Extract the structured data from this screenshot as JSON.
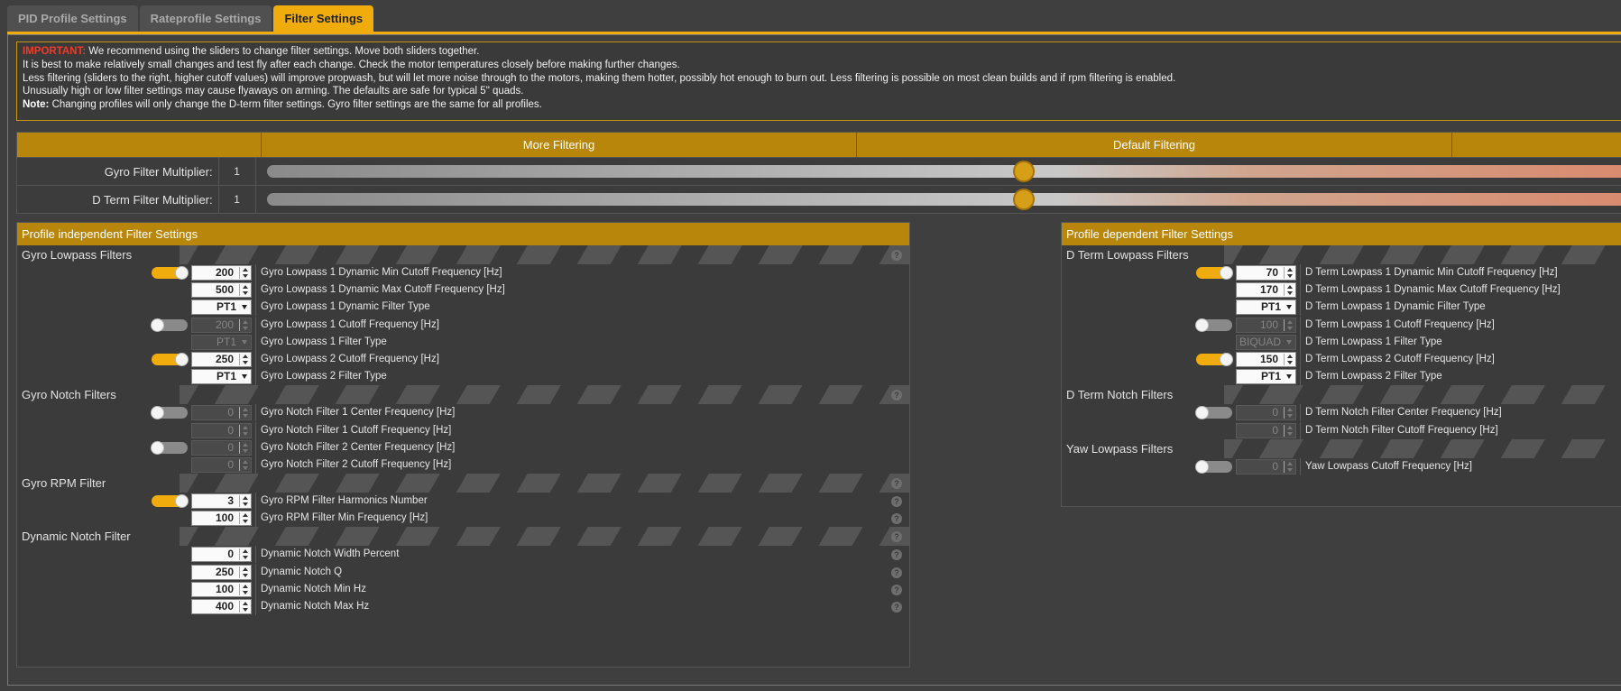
{
  "tabs": [
    {
      "label": "PID Profile Settings"
    },
    {
      "label": "Rateprofile Settings"
    },
    {
      "label": "Filter Settings"
    }
  ],
  "notice": {
    "important_label": "IMPORTANT:",
    "line1": " We recommend using the sliders to change filter settings. Move both sliders together.",
    "line2": "It is best to make relatively small changes and test fly after each change. Check the motor temperatures closely before making further changes.",
    "line3": "Less filtering (sliders to the right, higher cutoff values) will improve propwash, but will let more noise through to the motors, making them hotter, possibly hot enough to burn out. Less filtering is possible on most clean builds and if rpm filtering is enabled.",
    "line4": "Unusually high or low filter settings may cause flyaways on arming. The defaults are safe for typical 5\" quads.",
    "note_label": "Note:",
    "line5": " Changing profiles will only change the D-term filter settings. Gyro filter settings are the same for all profiles."
  },
  "sliders": {
    "more_filtering": "More Filtering",
    "default_filtering": "Default Filtering",
    "gyro_label": "Gyro Filter Multiplier:",
    "gyro_value": "1",
    "gyro_position": 0.555,
    "dterm_label": "D Term Filter Multiplier:",
    "dterm_value": "1",
    "dterm_position": 0.555
  },
  "left": {
    "title": "Profile independent Filter Settings",
    "help": "?",
    "gyro_lowpass": {
      "title": "Gyro Lowpass Filters",
      "r1": {
        "value": "200",
        "label": "Gyro Lowpass 1 Dynamic Min Cutoff Frequency [Hz]"
      },
      "r2": {
        "value": "500",
        "label": "Gyro Lowpass 1 Dynamic Max Cutoff Frequency [Hz]"
      },
      "r3": {
        "value": "PT1",
        "label": "Gyro Lowpass 1 Dynamic Filter Type"
      },
      "r4": {
        "value": "200",
        "label": "Gyro Lowpass 1 Cutoff Frequency [Hz]"
      },
      "r5": {
        "value": "PT1",
        "label": "Gyro Lowpass 1 Filter Type"
      },
      "r6": {
        "value": "250",
        "label": "Gyro Lowpass 2 Cutoff Frequency [Hz]"
      },
      "r7": {
        "value": "PT1",
        "label": "Gyro Lowpass 2 Filter Type"
      }
    },
    "gyro_notch": {
      "title": "Gyro Notch Filters",
      "r1": {
        "value": "0",
        "label": "Gyro Notch Filter 1 Center Frequency [Hz]"
      },
      "r2": {
        "value": "0",
        "label": "Gyro Notch Filter 1 Cutoff Frequency [Hz]"
      },
      "r3": {
        "value": "0",
        "label": "Gyro Notch Filter 2 Center Frequency [Hz]"
      },
      "r4": {
        "value": "0",
        "label": "Gyro Notch Filter 2 Cutoff Frequency [Hz]"
      }
    },
    "gyro_rpm": {
      "title": "Gyro RPM Filter",
      "r1": {
        "value": "3",
        "label": "Gyro RPM Filter Harmonics Number"
      },
      "r2": {
        "value": "100",
        "label": "Gyro RPM Filter Min Frequency [Hz]"
      }
    },
    "dyn_notch": {
      "title": "Dynamic Notch Filter",
      "r1": {
        "value": "0",
        "label": "Dynamic Notch Width Percent"
      },
      "r2": {
        "value": "250",
        "label": "Dynamic Notch Q"
      },
      "r3": {
        "value": "100",
        "label": "Dynamic Notch Min Hz"
      },
      "r4": {
        "value": "400",
        "label": "Dynamic Notch Max Hz"
      }
    }
  },
  "right": {
    "title": "Profile dependent Filter Settings",
    "dterm_lowpass": {
      "title": "D Term Lowpass Filters",
      "r1": {
        "value": "70",
        "label": "D Term Lowpass 1 Dynamic Min Cutoff Frequency [Hz]"
      },
      "r2": {
        "value": "170",
        "label": "D Term Lowpass 1 Dynamic Max Cutoff Frequency [Hz]"
      },
      "r3": {
        "value": "PT1",
        "label": "D Term Lowpass 1 Dynamic Filter Type"
      },
      "r4": {
        "value": "100",
        "label": "D Term Lowpass 1 Cutoff Frequency [Hz]"
      },
      "r5": {
        "value": "BIQUAD",
        "label": "D Term Lowpass 1 Filter Type"
      },
      "r6": {
        "value": "150",
        "label": "D Term Lowpass 2 Cutoff Frequency [Hz]"
      },
      "r7": {
        "value": "PT1",
        "label": "D Term Lowpass 2 Filter Type"
      }
    },
    "dterm_notch": {
      "title": "D Term Notch Filters",
      "r1": {
        "value": "0",
        "label": "D Term Notch Filter Center Frequency [Hz]"
      },
      "r2": {
        "value": "0",
        "label": "D Term Notch Filter Cutoff Frequency [Hz]"
      }
    },
    "yaw_lowpass": {
      "title": "Yaw Lowpass Filters",
      "r1": {
        "value": "0",
        "label": "Yaw Lowpass Cutoff Frequency [Hz]"
      }
    }
  }
}
